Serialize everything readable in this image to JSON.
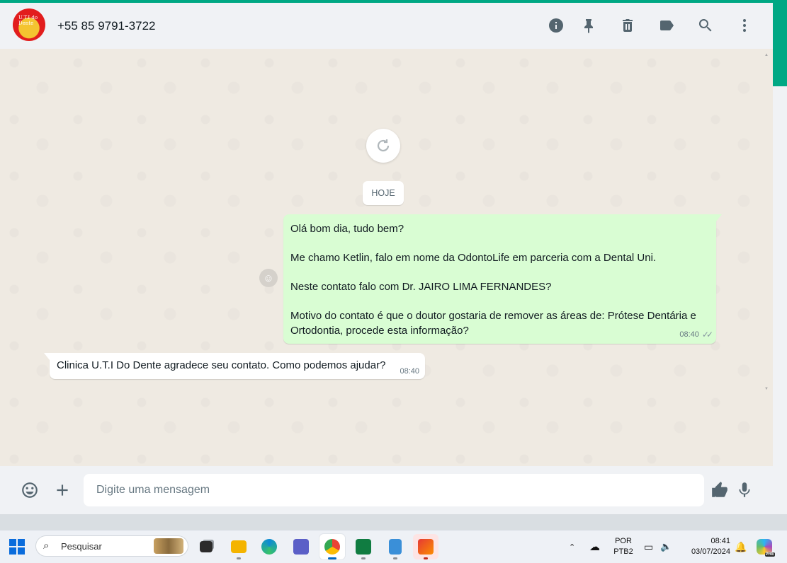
{
  "header": {
    "contact_name": "+55 85 9791-3722",
    "avatar_label": "U.T.I do Dente",
    "icons": [
      "info-icon",
      "pin-icon",
      "delete-icon",
      "label-icon",
      "search-icon",
      "menu-icon"
    ]
  },
  "chat": {
    "date_chip": "HOJE",
    "outgoing": {
      "lines": [
        "Olá bom dia, tudo bem?",
        "Me chamo Ketlin, falo em nome da OdontoLife em parceria com a Dental Uni.",
        "Neste contato falo com Dr. JAIRO LIMA FERNANDES?",
        "Motivo do contato é que o doutor gostaria de remover as áreas de: Prótese Dentária e Ortodontia, procede esta informação?"
      ],
      "time": "08:40",
      "status": "read"
    },
    "incoming": {
      "text": "Clinica U.T.I Do Dente agradece seu contato. Como podemos ajudar?",
      "time": "08:40"
    }
  },
  "composer": {
    "placeholder": "Digite uma mensagem"
  },
  "taskbar": {
    "search_label": "Pesquisar",
    "language_top": "POR",
    "language_bottom": "PTB2",
    "time": "08:41",
    "date": "03/07/2024",
    "badge": "PRE"
  },
  "colors": {
    "accent": "#00a884",
    "outgoing_bubble": "#d9fdd3",
    "chat_background": "#efeae2",
    "header_background": "#f0f2f5"
  }
}
